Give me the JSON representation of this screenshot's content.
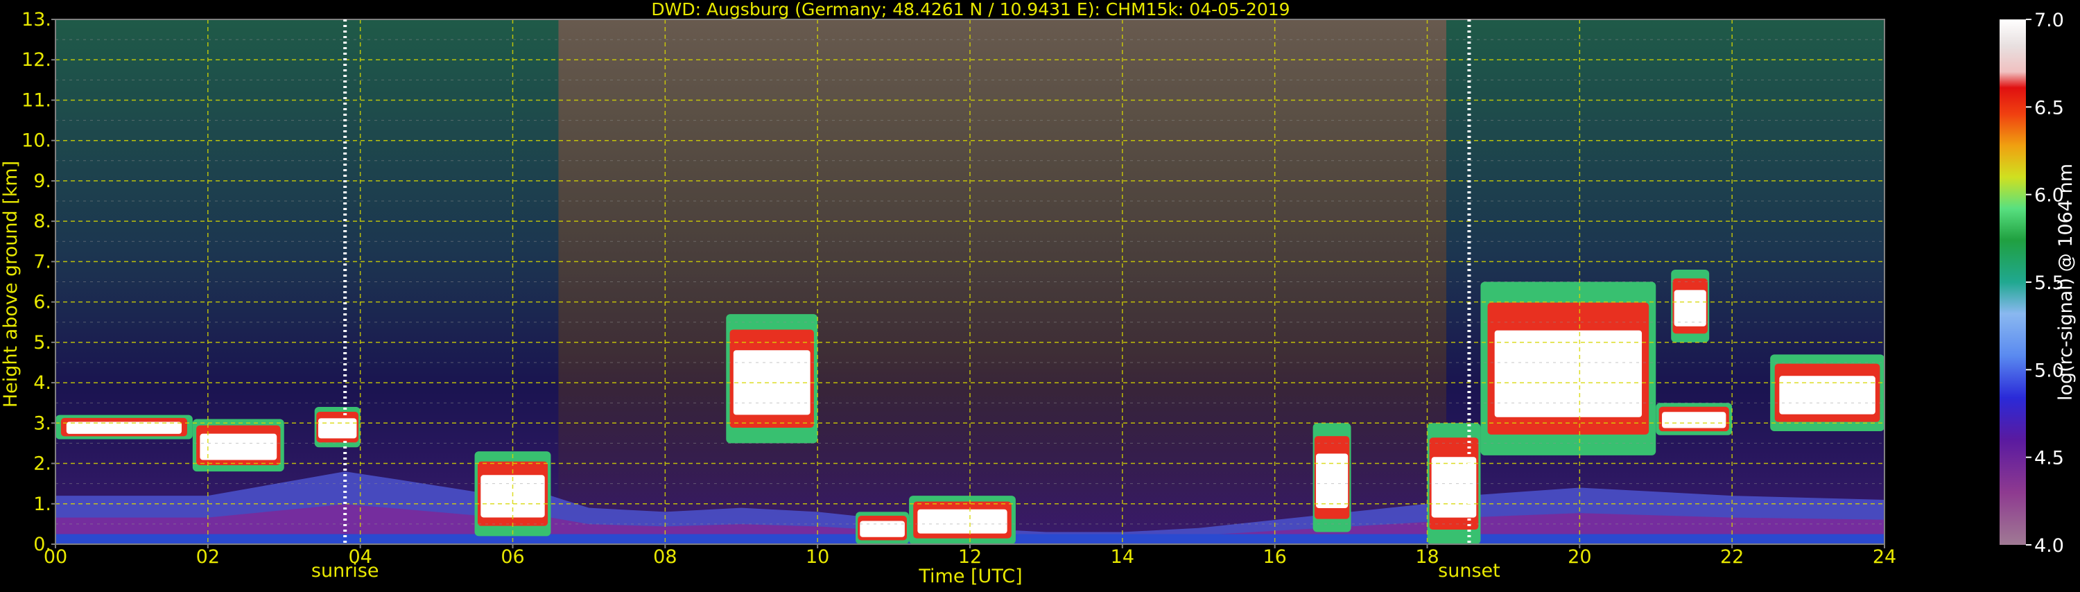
{
  "title": "DWD: Augsburg (Germany; 48.4261 N / 10.9431 E):    CHM15k: 04-05-2019",
  "chart_data": {
    "type": "heatmap",
    "title": "DWD: Augsburg (Germany; 48.4261 N / 10.9431 E):    CHM15k: 04-05-2019",
    "xlabel": "Time [UTC]",
    "ylabel": "Height above ground [km]",
    "xlim": [
      0,
      24
    ],
    "ylim": [
      0,
      13
    ],
    "x_ticks": [
      "00",
      "02",
      "04",
      "06",
      "08",
      "10",
      "12",
      "14",
      "16",
      "18",
      "20",
      "22",
      "24"
    ],
    "y_ticks": [
      "0.",
      "1.",
      "2.",
      "3.",
      "4.",
      "5.",
      "6.",
      "7.",
      "8.",
      "9.",
      "10.",
      "11.",
      "12.",
      "13."
    ],
    "grid": true,
    "annotations": [
      {
        "label": "sunrise",
        "time": 3.8
      },
      {
        "label": "sunset",
        "time": 18.55
      }
    ],
    "colorbar": {
      "label": "log(rc-signal) @ 1064 nm",
      "range": [
        4.0,
        7.0
      ],
      "ticks": [
        "4.0",
        "4.5",
        "5.0",
        "5.5",
        "6.0",
        "6.5",
        "7.0"
      ]
    },
    "layers": {
      "aerosol_top_km": [
        [
          0,
          1.2
        ],
        [
          2,
          1.2
        ],
        [
          3.8,
          1.8
        ],
        [
          4.5,
          1.6
        ],
        [
          5.5,
          1.3
        ],
        [
          6.5,
          1.2
        ],
        [
          7,
          0.9
        ],
        [
          8,
          0.8
        ],
        [
          9,
          0.9
        ],
        [
          10,
          0.8
        ],
        [
          11,
          0.6
        ],
        [
          12,
          0.4
        ],
        [
          13,
          0.3
        ],
        [
          14,
          0.3
        ],
        [
          15,
          0.4
        ],
        [
          16,
          0.6
        ],
        [
          17,
          0.8
        ],
        [
          18,
          1.0
        ],
        [
          18.5,
          1.2
        ],
        [
          20,
          1.4
        ],
        [
          22,
          1.2
        ],
        [
          24,
          1.1
        ]
      ],
      "cloud_layers": [
        {
          "t0": 0.0,
          "t1": 1.8,
          "base_km": 2.6,
          "top_km": 3.2
        },
        {
          "t0": 1.8,
          "t1": 3.0,
          "base_km": 1.8,
          "top_km": 3.1
        },
        {
          "t0": 3.4,
          "t1": 4.0,
          "base_km": 2.4,
          "top_km": 3.4
        },
        {
          "t0": 5.5,
          "t1": 6.5,
          "base_km": 0.2,
          "top_km": 2.3
        },
        {
          "t0": 8.8,
          "t1": 10.0,
          "base_km": 2.5,
          "top_km": 5.7
        },
        {
          "t0": 10.5,
          "t1": 11.2,
          "base_km": 0.0,
          "top_km": 0.8
        },
        {
          "t0": 11.2,
          "t1": 12.6,
          "base_km": 0.0,
          "top_km": 1.2
        },
        {
          "t0": 16.5,
          "t1": 17.0,
          "base_km": 0.3,
          "top_km": 3.0
        },
        {
          "t0": 18.0,
          "t1": 18.7,
          "base_km": 0.0,
          "top_km": 3.0
        },
        {
          "t0": 18.7,
          "t1": 21.0,
          "base_km": 2.2,
          "top_km": 6.5
        },
        {
          "t0": 21.0,
          "t1": 22.0,
          "base_km": 2.7,
          "top_km": 3.5
        },
        {
          "t0": 21.2,
          "t1": 21.7,
          "base_km": 5.0,
          "top_km": 6.8
        },
        {
          "t0": 22.5,
          "t1": 24.0,
          "base_km": 2.8,
          "top_km": 4.7
        }
      ]
    }
  }
}
